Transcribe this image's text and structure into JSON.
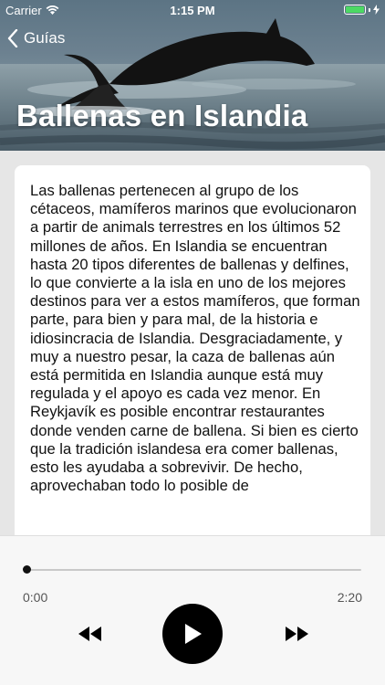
{
  "status_bar": {
    "carrier": "Carrier",
    "time": "1:15 PM"
  },
  "nav": {
    "back_label": "Guías"
  },
  "hero": {
    "title": "Ballenas en Islandia"
  },
  "article": {
    "body": "Las ballenas pertenecen al grupo de los cétaceos, mamíferos marinos que evolucionaron a partir de animals terrestres en los últimos 52 millones de años. En Islandia se encuentran hasta 20 tipos diferentes de ballenas y delfines, lo que convierte a la isla en uno de los mejores destinos para ver a estos mamíferos, que forman parte, para bien y para mal, de la historia e idiosincracia de Islandia. Desgraciadamente, y muy a nuestro pesar, la caza de ballenas aún está permitida en Islandia aunque está muy regulada y el apoyo es cada vez menor. En Reykjavík es posible encontrar restaurantes donde venden carne de ballena. Si bien es cierto que la tradición islandesa era comer ballenas, esto les ayudaba a sobrevivir. De hecho, aprovechaban todo lo posible de"
  },
  "player": {
    "current_time": "0:00",
    "duration": "2:20",
    "progress": 0,
    "icons": {
      "rewind": "rewind-icon",
      "play": "play-icon",
      "forward": "fast-forward-icon"
    }
  },
  "colors": {
    "battery": "#4cd964",
    "play_button": "#000000"
  }
}
